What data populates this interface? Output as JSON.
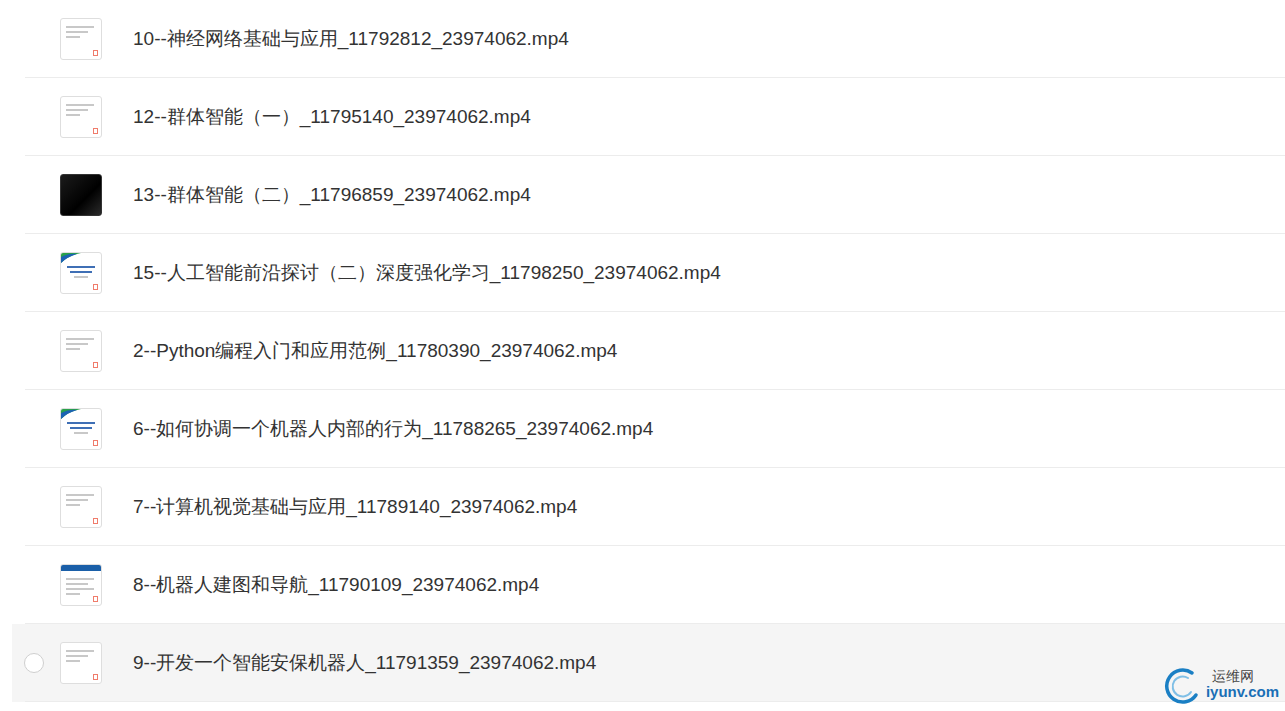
{
  "files": [
    {
      "name": "10--神经网络基础与应用_11792812_23974062.mp4",
      "kind": "doc",
      "hovered": false,
      "checked": false
    },
    {
      "name": "12--群体智能（一）_11795140_23974062.mp4",
      "kind": "doc",
      "hovered": false,
      "checked": false
    },
    {
      "name": "13--群体智能（二）_11796859_23974062.mp4",
      "kind": "dark",
      "hovered": false,
      "checked": false
    },
    {
      "name": "15--人工智能前沿探讨（二）深度强化学习_11798250_23974062.mp4",
      "kind": "slide",
      "hovered": false,
      "checked": false
    },
    {
      "name": "2--Python编程入门和应用范例_11780390_23974062.mp4",
      "kind": "doc",
      "hovered": false,
      "checked": false
    },
    {
      "name": "6--如何协调一个机器人内部的行为_11788265_23974062.mp4",
      "kind": "slide",
      "hovered": false,
      "checked": false
    },
    {
      "name": "7--计算机视觉基础与应用_11789140_23974062.mp4",
      "kind": "doc",
      "hovered": false,
      "checked": false
    },
    {
      "name": "8--机器人建图和导航_11790109_23974062.mp4",
      "kind": "banner",
      "hovered": false,
      "checked": false
    },
    {
      "name": "9--开发一个智能安保机器人_11791359_23974062.mp4",
      "kind": "doc",
      "hovered": true,
      "checked": false
    }
  ],
  "watermark": {
    "title": "运维网",
    "site": "iyunv.com"
  }
}
